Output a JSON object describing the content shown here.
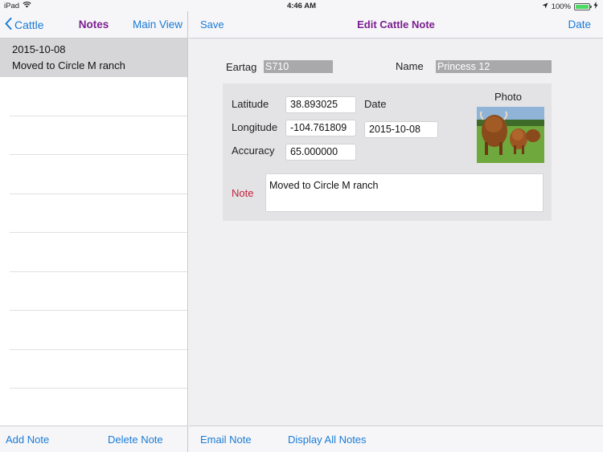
{
  "status_bar": {
    "device": "iPad",
    "time": "4:46 AM",
    "battery": "100%"
  },
  "left_nav": {
    "back_label": "Cattle",
    "title": "Notes",
    "right_label": "Main View"
  },
  "notes": [
    {
      "date": "2015-10-08",
      "text": "Moved to Circle M ranch"
    }
  ],
  "left_toolbar": {
    "add_label": "Add Note",
    "delete_label": "Delete Note"
  },
  "right_nav": {
    "left_label": "Save",
    "title": "Edit Cattle Note",
    "right_label": "Date"
  },
  "form": {
    "eartag_label": "Eartag",
    "eartag_value": "S710",
    "name_label": "Name",
    "name_value": "Princess 12",
    "latitude_label": "Latitude",
    "latitude_value": "38.893025",
    "longitude_label": "Longitude",
    "longitude_value": "-104.761809",
    "accuracy_label": "Accuracy",
    "accuracy_value": "65.000000",
    "date_label": "Date",
    "date_value": "2015-10-08",
    "photo_label": "Photo",
    "note_label": "Note",
    "note_value": "Moved to Circle M ranch"
  },
  "right_toolbar": {
    "email_label": "Email Note",
    "display_all_label": "Display All Notes"
  },
  "colors": {
    "accent": "#1a7bd6",
    "title": "#7b1f8f",
    "note_label": "#c0223d",
    "battery": "#4cd964"
  }
}
